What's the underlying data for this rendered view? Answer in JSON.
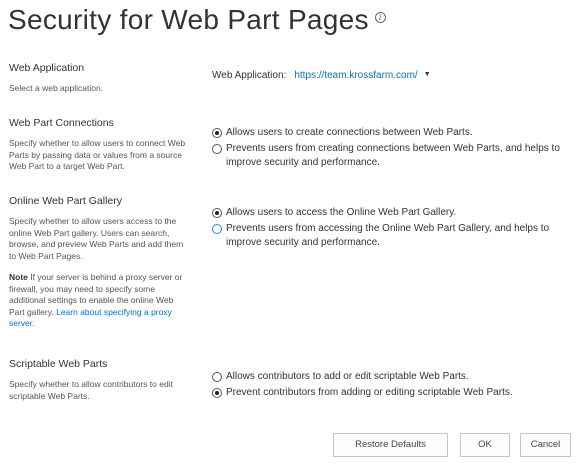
{
  "page": {
    "title": "Security for Web Part Pages",
    "info_icon": "info-icon"
  },
  "web_application": {
    "title": "Web Application",
    "description": "Select a web application.",
    "label": "Web Application:",
    "value": "https://team.krossfarm.com/",
    "dropdown_icon": "chevron-down-icon"
  },
  "web_part_connections": {
    "title": "Web Part Connections",
    "description": "Specify whether to allow users to connect Web Parts by passing data or values from a source Web Part to a target Web Part.",
    "options": [
      {
        "label": "Allows users to create connections between Web Parts.",
        "selected": true
      },
      {
        "label": "Prevents users from creating connections between Web Parts, and helps to improve security and performance.",
        "selected": false
      }
    ]
  },
  "online_gallery": {
    "title": "Online Web Part Gallery",
    "description": "Specify whether to allow users access to the online Web Part gallery.  Users can search, browse, and preview Web Parts and add them to Web Part Pages.",
    "note_label": "Note",
    "note_text": " If your server is behind a proxy server or firewall, you may need to specify some additional settings to enable the online Web Part gallery. ",
    "note_link": "Learn about specifying a proxy server.",
    "options": [
      {
        "label": "Allows users to access the Online Web Part Gallery.",
        "selected": true
      },
      {
        "label": "Prevents users from accessing the Online Web Part Gallery, and helps to improve security and performance.",
        "selected": false
      }
    ]
  },
  "scriptable": {
    "title": "Scriptable Web Parts",
    "description": "Specify whether to allow contributors to edit scriptable Web Parts.",
    "options": [
      {
        "label": "Allows contributors to add or edit scriptable Web Parts.",
        "selected": false
      },
      {
        "label": "Prevent contributors from adding or editing scriptable Web Parts.",
        "selected": true
      }
    ]
  },
  "buttons": {
    "restore": "Restore Defaults",
    "ok": "OK",
    "cancel": "Cancel"
  }
}
